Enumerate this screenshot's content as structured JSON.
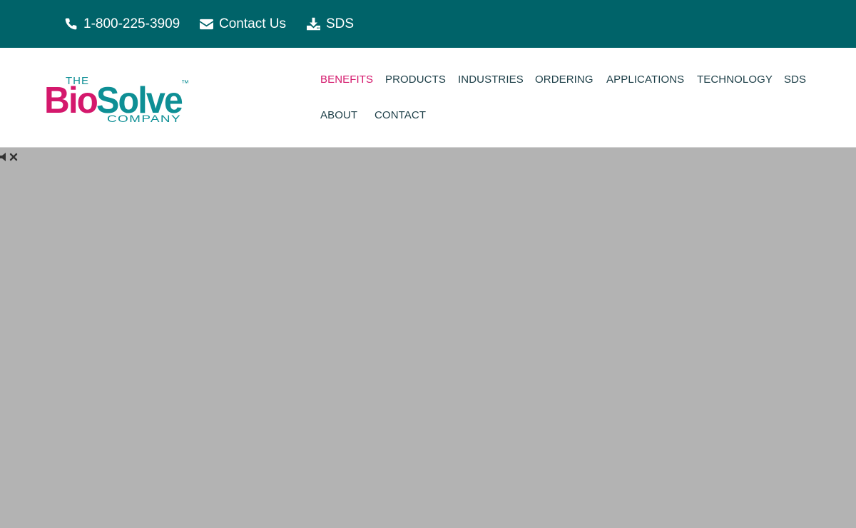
{
  "topbar": {
    "phone": "1-800-225-3909",
    "contact": "Contact Us",
    "sds": "SDS",
    "icons": [
      "phone-icon",
      "envelope-icon",
      "download-icon"
    ],
    "background": "#006369"
  },
  "logo": {
    "the": "THE",
    "bio": "Bio",
    "solve": "Solve",
    "tm": "™",
    "company": "COMPANY",
    "colors": {
      "bio": "#d4186c",
      "solve": "#0e8f95"
    }
  },
  "nav": {
    "items": [
      {
        "label": "BENEFITS",
        "active": true
      },
      {
        "label": "PRODUCTS"
      },
      {
        "label": "INDUSTRIES"
      },
      {
        "label": "ORDERING"
      },
      {
        "label": "APPLICATIONS"
      },
      {
        "label": "TECHNOLOGY"
      },
      {
        "label": "SDS"
      },
      {
        "label": "ABOUT"
      },
      {
        "label": "CONTACT"
      }
    ],
    "active_color": "#d4186c",
    "color": "#1c3e47"
  },
  "video": {
    "background": "#b3b3b3",
    "controls": [
      "mute-icon",
      "close-icon"
    ]
  }
}
